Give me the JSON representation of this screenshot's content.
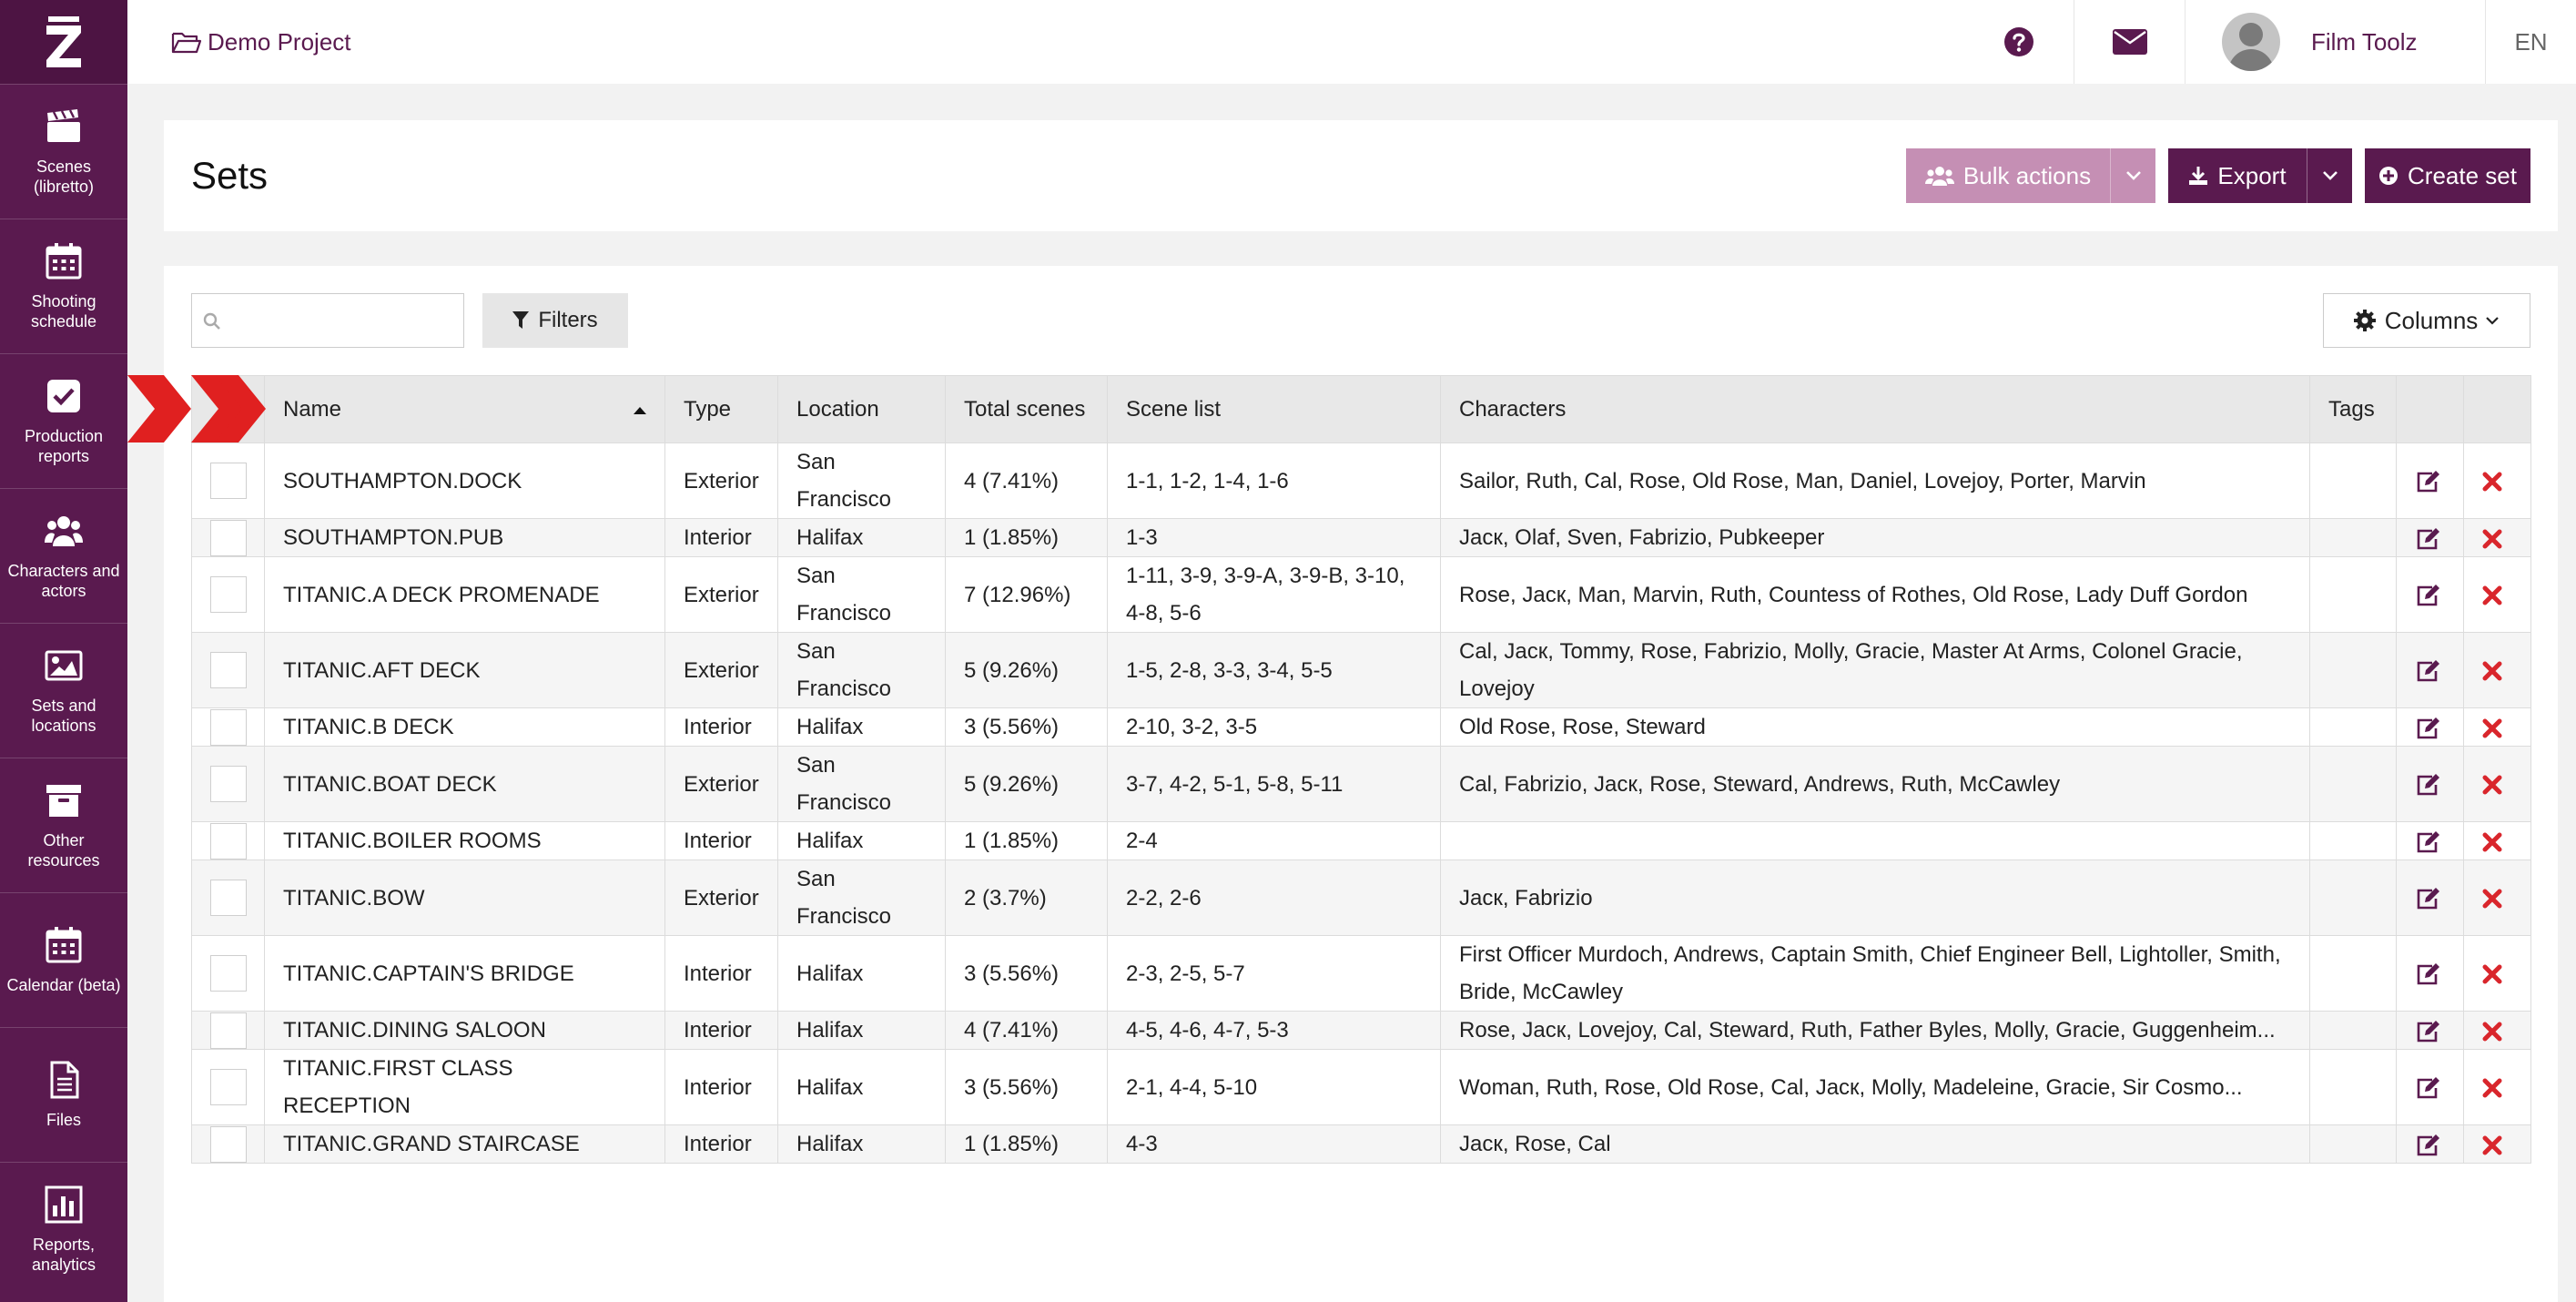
{
  "app": {
    "project_name": "Demo Project",
    "user_name": "Film Toolz",
    "language": "EN",
    "brand_color": "#5a1a4f"
  },
  "sidebar": {
    "items": [
      {
        "label": "Scenes (libretto)",
        "icon": "clapperboard-icon"
      },
      {
        "label": "Shooting schedule",
        "icon": "calendar-icon"
      },
      {
        "label": "Production reports",
        "icon": "checkbox-icon"
      },
      {
        "label": "Characters and actors",
        "icon": "users-icon"
      },
      {
        "label": "Sets and locations",
        "icon": "image-icon"
      },
      {
        "label": "Other resources",
        "icon": "archive-icon"
      },
      {
        "label": "Calendar (beta)",
        "icon": "calendar-icon"
      },
      {
        "label": "Files",
        "icon": "file-icon"
      },
      {
        "label": "Reports, analytics",
        "icon": "bar-chart-icon"
      }
    ]
  },
  "page": {
    "title": "Sets",
    "bulk_actions_label": "Bulk actions",
    "export_label": "Export",
    "create_label": "Create set",
    "filters_label": "Filters",
    "columns_label": "Columns",
    "search_placeholder": ""
  },
  "table": {
    "headers": {
      "name": "Name",
      "type": "Type",
      "location": "Location",
      "total_scenes": "Total scenes",
      "scene_list": "Scene list",
      "characters": "Characters",
      "tags": "Tags"
    },
    "rows": [
      {
        "name": "SOUTHAMPTON.DOCK",
        "type": "Exterior",
        "location": "San Francisco",
        "total": "4 (7.41%)",
        "scenes": "1-1, 1-2, 1-4, 1-6",
        "characters": "Sailor, Ruth, Cal, Rose, Old Rose, Man, Daniel, Lovejoy, Porter, Marvin",
        "tags": ""
      },
      {
        "name": "SOUTHAMPTON.PUB",
        "type": "Interior",
        "location": "Halifax",
        "total": "1 (1.85%)",
        "scenes": "1-3",
        "characters": "Jacк, Olaf, Sven, Fabrizio, Pubkeeper",
        "tags": ""
      },
      {
        "name": "TITANIC.A DECK PROMENADE",
        "type": "Exterior",
        "location": "San Francisco",
        "total": "7 (12.96%)",
        "scenes": "1-11, 3-9, 3-9-A, 3-9-B, 3-10, 4-8, 5-6",
        "characters": "Rose, Jacк, Man, Marvin, Ruth, Countess of Rothes, Old Rose, Lady Duff Gordon",
        "tags": ""
      },
      {
        "name": "TITANIC.AFT DECK",
        "type": "Exterior",
        "location": "San Francisco",
        "total": "5 (9.26%)",
        "scenes": "1-5, 2-8, 3-3, 3-4, 5-5",
        "characters": "Cal, Jacк, Tommy, Rose, Fabrizio, Molly, Gracie, Master At Arms, Colonel Gracie, Lovejoy",
        "tags": ""
      },
      {
        "name": "TITANIC.B DECK",
        "type": "Interior",
        "location": "Halifax",
        "total": "3 (5.56%)",
        "scenes": "2-10, 3-2, 3-5",
        "characters": "Old Rose, Rose, Steward",
        "tags": ""
      },
      {
        "name": "TITANIC.BOAT DECK",
        "type": "Exterior",
        "location": "San Francisco",
        "total": "5 (9.26%)",
        "scenes": "3-7, 4-2, 5-1, 5-8, 5-11",
        "characters": "Cal, Fabrizio, Jacк, Rose, Steward, Andrews, Ruth, McCawley",
        "tags": ""
      },
      {
        "name": "TITANIC.BOILER ROOMS",
        "type": "Interior",
        "location": "Halifax",
        "total": "1 (1.85%)",
        "scenes": "2-4",
        "characters": "",
        "tags": ""
      },
      {
        "name": "TITANIC.BOW",
        "type": "Exterior",
        "location": "San Francisco",
        "total": "2 (3.7%)",
        "scenes": "2-2, 2-6",
        "characters": "Jacк, Fabrizio",
        "tags": ""
      },
      {
        "name": "TITANIC.CAPTAIN'S BRIDGE",
        "type": "Interior",
        "location": "Halifax",
        "total": "3 (5.56%)",
        "scenes": "2-3, 2-5, 5-7",
        "characters": "First Officer Murdoch, Andrews, Captain Smith, Chief Engineer Bell, Lightoller, Smith, Bride, McCawley",
        "tags": ""
      },
      {
        "name": "TITANIC.DINING SALOON",
        "type": "Interior",
        "location": "Halifax",
        "total": "4 (7.41%)",
        "scenes": "4-5, 4-6, 4-7, 5-3",
        "characters": "Rose, Jacк, Lovejoy, Cal, Steward, Ruth, Father Byles, Molly, Gracie, Guggenheim...",
        "tags": ""
      },
      {
        "name": "TITANIC.FIRST CLASS RECEPTION",
        "type": "Interior",
        "location": "Halifax",
        "total": "3 (5.56%)",
        "scenes": "2-1, 4-4, 5-10",
        "characters": "Woman, Ruth, Rose, Old Rose, Cal, Jacк, Molly, Madeleine, Gracie, Sir Cosmo...",
        "tags": ""
      },
      {
        "name": "TITANIC.GRAND STAIRCASE",
        "type": "Interior",
        "location": "Halifax",
        "total": "1 (1.85%)",
        "scenes": "4-3",
        "characters": "Jacк, Rose, Cal",
        "tags": ""
      }
    ]
  }
}
